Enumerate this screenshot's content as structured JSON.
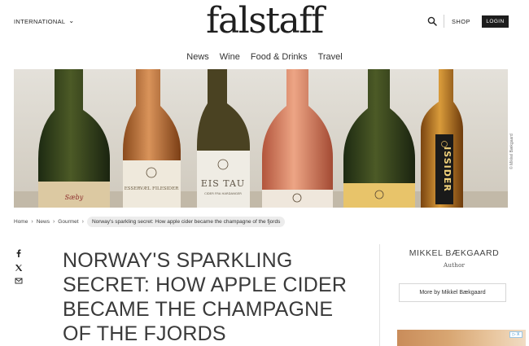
{
  "header": {
    "region_label": "INTERNATIONAL",
    "logo_text": "falstaff",
    "shop_label": "SHOP",
    "login_label": "LOGIN"
  },
  "nav": {
    "items": [
      "News",
      "Wine",
      "Food & Drinks",
      "Travel"
    ]
  },
  "hero": {
    "photo_credit": "© Mikkel Bækgaard",
    "bottle_labels": [
      "Sæby",
      "ESSERVÆL FILESIDER",
      "EIS TAU",
      "CIDER FRA HARDANGER",
      "ISSIDER"
    ]
  },
  "breadcrumb": {
    "items": [
      "Home",
      "News",
      "Gourmet"
    ],
    "current": "Norway's sparkling secret: How apple cider became the champagne of the fjords"
  },
  "share": {
    "icons": [
      "facebook-icon",
      "x-icon",
      "mail-icon"
    ]
  },
  "article": {
    "title": "Norway's sparkling secret: How apple cider became the champagne of the fjords"
  },
  "author": {
    "name": "MIKKEL BÆKGAARD",
    "role": "Author",
    "more_label": "More by Mikkel Bækgaard"
  },
  "ad": {
    "choice_label": "▷ X"
  },
  "colors": {
    "login_bg": "#1d1d1d",
    "text": "#222222",
    "breadcrumb_pill": "#ececec"
  }
}
